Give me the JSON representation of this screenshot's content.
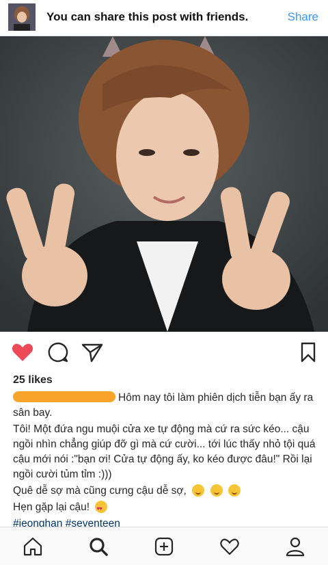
{
  "banner": {
    "text": "You can share this post with friends.",
    "share_label": "Share"
  },
  "post": {
    "likes": "25 likes",
    "caption_lines": [
      "Hôm nay tôi làm phiên dịch tiễn bạn ấy ra sân bay.",
      "Tôi! Một đứa ngu muội cửa xe tự động mà cứ ra sức kéo... cậu ngồi nhìn chẳng giúp đỡ gì mà cứ cười... tới lúc thấy nhỏ tội quá cậu mới nói :\"bạn ơi! Cửa tự động ấy, ko kéo được đâu!\" Rồi lại ngồi cười tủm tỉm :)))",
      "Quê dễ sợ mà cũng cưng cậu dễ sợ,",
      "Hẹn gặp lại cậu!"
    ],
    "hashtags": "#jeonghan #seventeen"
  },
  "actions": {
    "like": "heart-icon",
    "comment": "comment-icon",
    "share": "send-icon",
    "save": "bookmark-icon"
  },
  "nav": [
    "home-icon",
    "search-icon",
    "add-icon",
    "activity-heart-icon",
    "profile-icon"
  ],
  "colors": {
    "accent": "#3897f0",
    "like_red": "#ed4956",
    "hashtag": "#003569",
    "highlight": "#f8a42a"
  }
}
